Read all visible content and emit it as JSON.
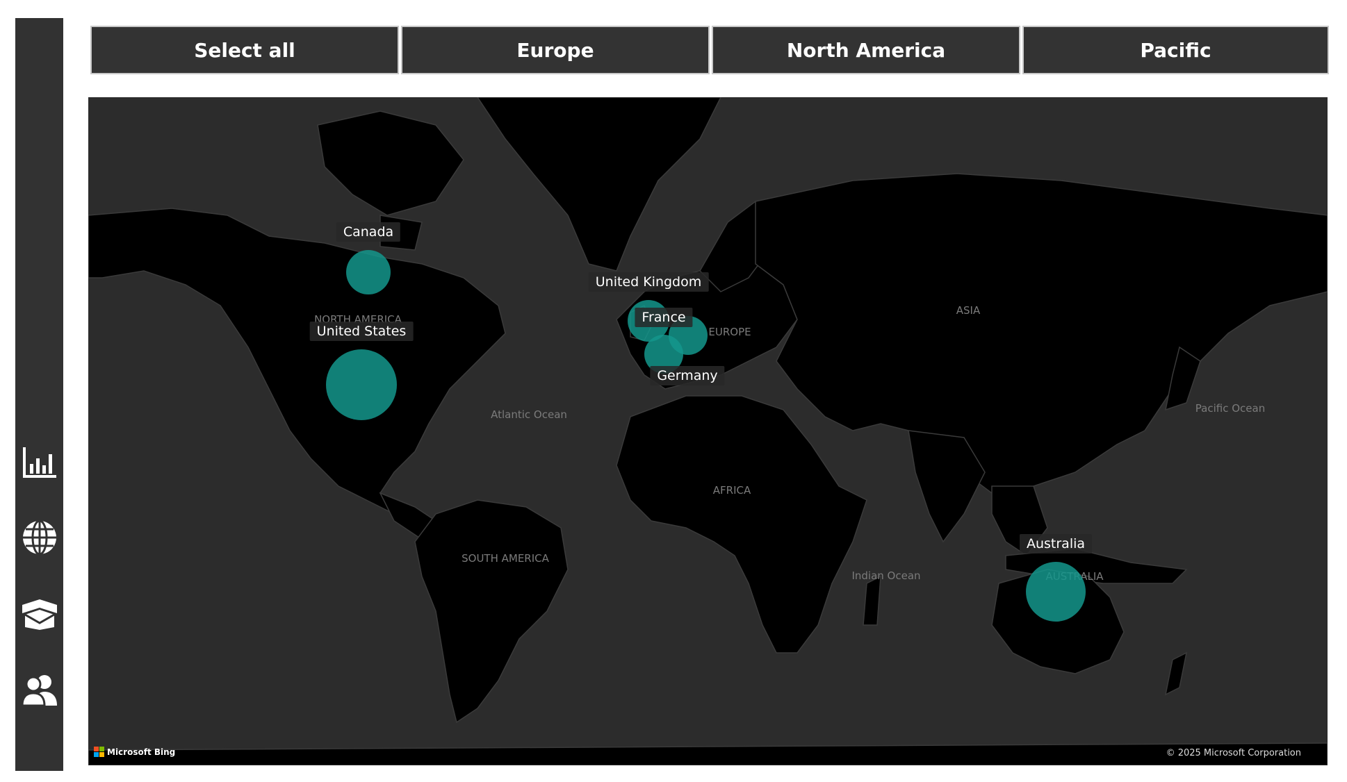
{
  "slicers": [
    {
      "label": "Select all"
    },
    {
      "label": "Europe"
    },
    {
      "label": "North America"
    },
    {
      "label": "Pacific"
    }
  ],
  "nav": [
    {
      "icon": "bar-chart-icon"
    },
    {
      "icon": "globe-icon"
    },
    {
      "icon": "package-icon"
    },
    {
      "icon": "people-icon"
    }
  ],
  "map": {
    "region_labels": [
      "NORTH AMERICA",
      "Atlantic Ocean",
      "SOUTH AMERICA",
      "EUROPE",
      "ASIA",
      "AFRICA",
      "Indian Ocean",
      "Pacific Ocean",
      "AUSTRALIA"
    ],
    "countries": [
      {
        "name": "Canada"
      },
      {
        "name": "United States"
      },
      {
        "name": "United Kingdom"
      },
      {
        "name": "France"
      },
      {
        "name": "Germany"
      },
      {
        "name": "Australia"
      }
    ],
    "bubble_color": "#14968c",
    "background": "#2c2c2c",
    "land_color": "#000000",
    "attribution": "Microsoft Bing",
    "copyright": "© 2025 Microsoft Corporation"
  }
}
